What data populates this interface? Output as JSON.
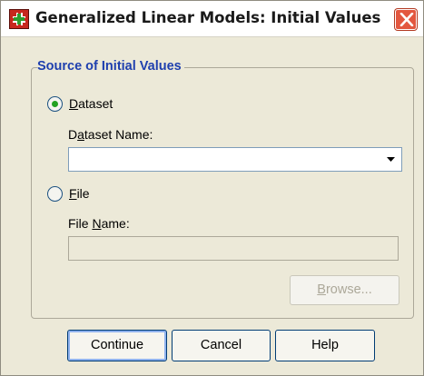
{
  "window": {
    "title": "Generalized Linear Models: Initial Values",
    "app_icon": "spss-app-icon",
    "close_icon": "close-icon"
  },
  "group": {
    "label": "Source of Initial Values"
  },
  "dataset_option": {
    "label": "Dataset",
    "mnemonic": "D",
    "label_rest": "ataset",
    "selected": true
  },
  "dataset_name": {
    "label_pre": "D",
    "mnemonic": "a",
    "label_rest": "taset Name:",
    "value": ""
  },
  "file_option": {
    "label": "File",
    "mnemonic": "F",
    "label_rest": "ile",
    "selected": false
  },
  "file_name": {
    "label_pre": "File ",
    "mnemonic": "N",
    "label_rest": "ame:",
    "value": ""
  },
  "buttons": {
    "browse_mnemonic": "B",
    "browse_rest": "rowse...",
    "continue": "Continue",
    "cancel": "Cancel",
    "help": "Help"
  },
  "colors": {
    "group_label": "#1e3fae",
    "radio_dot": "#21a121",
    "close_bg": "#e3573f"
  }
}
